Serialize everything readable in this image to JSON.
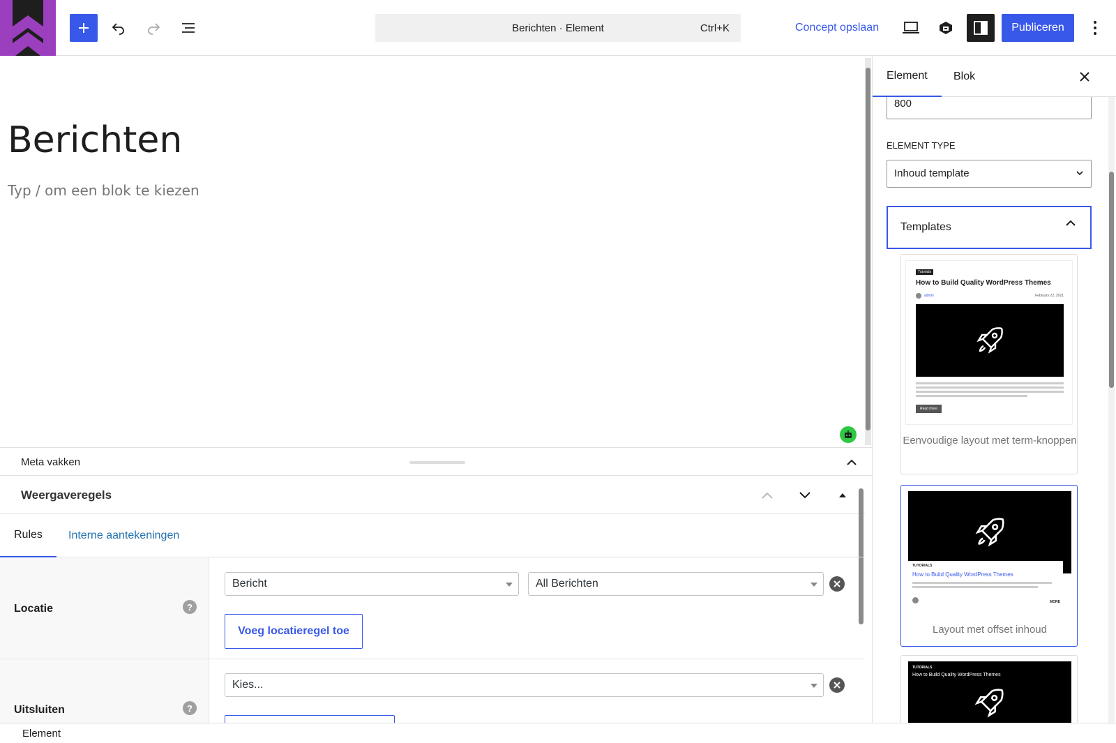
{
  "topbar": {
    "command_text": "Berichten · Element",
    "command_shortcut": "Ctrl+K",
    "save_draft": "Concept opslaan",
    "publish": "Publiceren"
  },
  "editor": {
    "title": "Berichten",
    "block_placeholder": "Typ / om een blok te kiezen"
  },
  "meta": {
    "label": "Meta vakken",
    "panel_title": "Weergaveregels",
    "tabs": [
      "Rules",
      "Interne aantekeningen"
    ],
    "location": {
      "label": "Locatie",
      "help": "?",
      "select1": "Bericht",
      "select2": "All Berichten",
      "add_button": "Voeg locatieregel toe"
    },
    "exclude": {
      "label": "Uitsluiten",
      "help": "?",
      "select": "Kies..."
    }
  },
  "footer": {
    "breadcrumb": "Element"
  },
  "sidebar": {
    "tabs": [
      "Element",
      "Blok"
    ],
    "input_value": "800",
    "element_type_label": "ELEMENT TYPE",
    "element_type_value": "Inhoud template",
    "templates_label": "Templates",
    "templates": [
      {
        "caption": "Eenvoudige layout met term-knoppen",
        "thumb_badge": "Tutorials",
        "thumb_title": "How to Build Quality WordPress Themes",
        "thumb_author": "admin",
        "thumb_date": "February 22, 2021",
        "thumb_button": "Read more"
      },
      {
        "caption": "Layout met offset inhoud",
        "thumb_badge": "TUTORIALS",
        "thumb_title": "How to Build Quality WordPress Themes",
        "thumb_more": "MORE"
      },
      {
        "thumb_badge": "TUTORIALS",
        "thumb_title": "How to Build Quality WordPress Themes"
      }
    ]
  },
  "colors": {
    "accent": "#3858e9",
    "logo_purple": "#9b3fbf",
    "robot_green": "#2ec943"
  }
}
